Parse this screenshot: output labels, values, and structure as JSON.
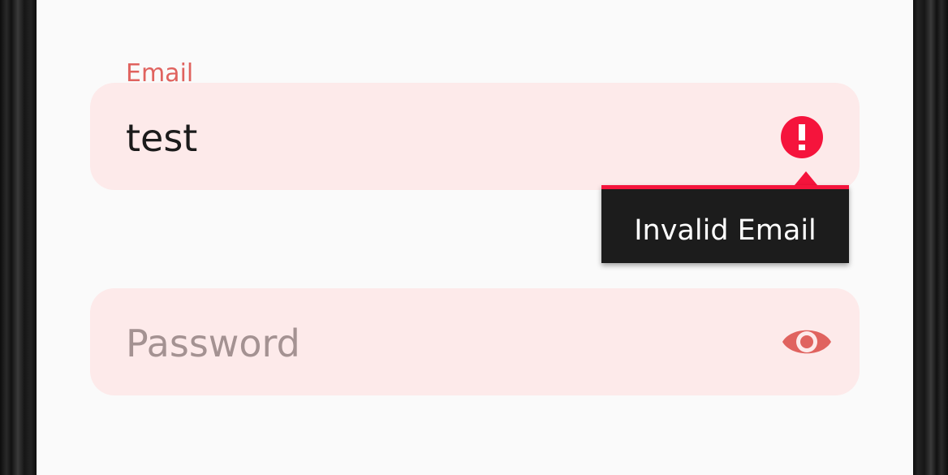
{
  "form": {
    "email": {
      "label": "Email",
      "value": "test",
      "error_icon": "error-exclamation-icon",
      "error_message": "Invalid Email"
    },
    "password": {
      "placeholder": "Password",
      "toggle_icon": "eye-icon"
    }
  },
  "colors": {
    "field_background": "#fdeaea",
    "label_accent": "#e0635f",
    "error": "#f5143c",
    "tooltip_background": "#1c1c1c",
    "screen_background": "#fafafa"
  }
}
